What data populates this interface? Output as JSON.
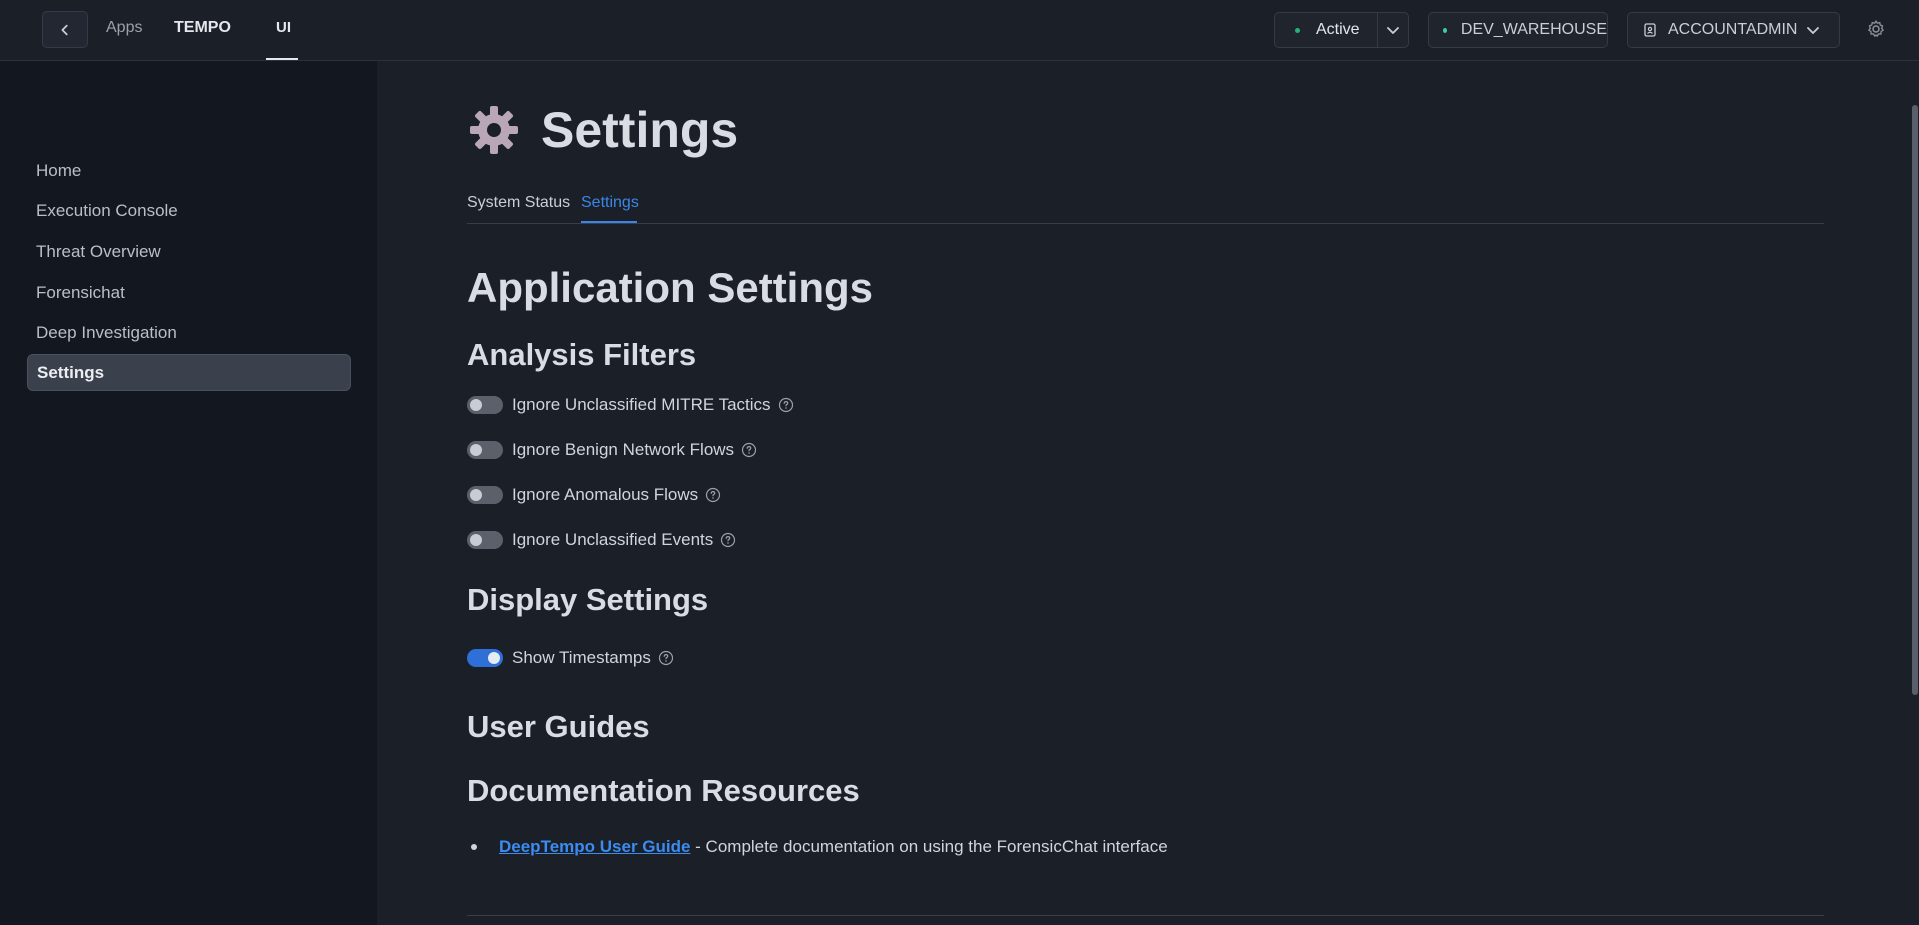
{
  "header": {
    "crumbs": {
      "apps": "Apps",
      "app": "TEMPO",
      "page": "UI"
    },
    "status": {
      "label": "Active",
      "color": "#27b07a"
    },
    "warehouse": {
      "label": "DEV_WAREHOUSE"
    },
    "role": {
      "label": "ACCOUNTADMIN"
    }
  },
  "sidebar": {
    "items": [
      {
        "label": "Home",
        "active": false
      },
      {
        "label": "Execution Console",
        "active": false
      },
      {
        "label": "Threat Overview",
        "active": false
      },
      {
        "label": "Forensichat",
        "active": false
      },
      {
        "label": "Deep Investigation",
        "active": false
      },
      {
        "label": "Settings",
        "active": true
      }
    ]
  },
  "main": {
    "page_title": "Settings",
    "tabs": [
      {
        "label": "System Status",
        "active": false
      },
      {
        "label": "Settings",
        "active": true
      }
    ],
    "app_settings_heading": "Application Settings",
    "analysis_filters": {
      "heading": "Analysis Filters",
      "toggles": [
        {
          "label": "Ignore Unclassified MITRE Tactics",
          "on": false
        },
        {
          "label": "Ignore Benign Network Flows",
          "on": false
        },
        {
          "label": "Ignore Anomalous Flows",
          "on": false
        },
        {
          "label": "Ignore Unclassified Events",
          "on": false
        }
      ]
    },
    "display_settings": {
      "heading": "Display Settings",
      "toggles": [
        {
          "label": "Show Timestamps",
          "on": true
        }
      ]
    },
    "user_guides_heading": "User Guides",
    "documentation": {
      "heading": "Documentation Resources",
      "items": [
        {
          "link_text": "DeepTempo User Guide",
          "description": " - Complete documentation on using the ForensicChat interface"
        }
      ]
    }
  },
  "colors": {
    "accent": "#3a86e8",
    "toggle_on": "#2f6fd8",
    "background": "#1b1f27",
    "sidebar": "#131720"
  }
}
